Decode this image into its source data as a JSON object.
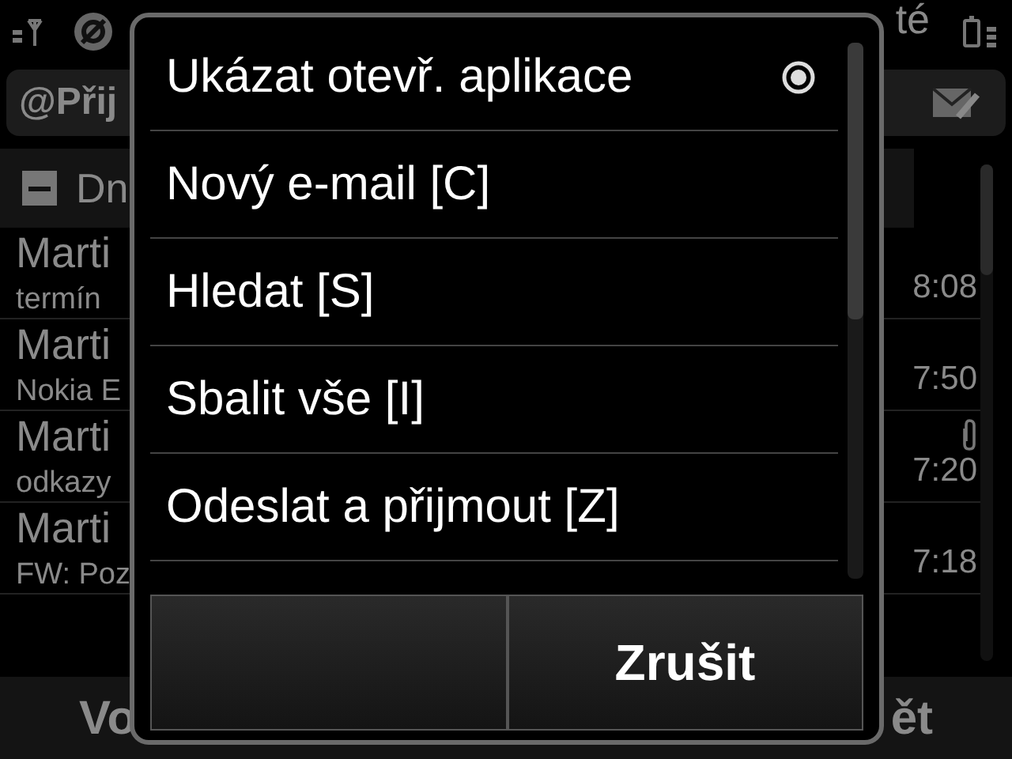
{
  "status_bar": {
    "title": "té"
  },
  "folder_tab": {
    "label": "@Přij"
  },
  "group_header": {
    "label": "Dn",
    "expanded": true
  },
  "messages": [
    {
      "sender": "Marti",
      "subject": "termín",
      "time": "8:08",
      "attachment": false
    },
    {
      "sender": "Marti",
      "subject": "Nokia E",
      "time": "7:50",
      "attachment": false
    },
    {
      "sender": "Marti",
      "subject": "odkazy",
      "time": "7:20",
      "attachment": true
    },
    {
      "sender": "Marti",
      "subject": "FW: Poz",
      "time": "7:18",
      "attachment": false
    }
  ],
  "softkeys": {
    "left": "Vo",
    "right": "ět"
  },
  "menu": {
    "items": [
      {
        "label": "Ukázat otevř. aplikace",
        "selected": true
      },
      {
        "label": "Nový e-mail [C]",
        "selected": false
      },
      {
        "label": "Hledat [S]",
        "selected": false
      },
      {
        "label": "Sbalit vše [I]",
        "selected": false
      },
      {
        "label": "Odeslat a přijmout [Z]",
        "selected": false
      }
    ],
    "buttons": [
      {
        "kind": "blank"
      },
      {
        "kind": "text",
        "label": "Zrušit"
      }
    ]
  }
}
